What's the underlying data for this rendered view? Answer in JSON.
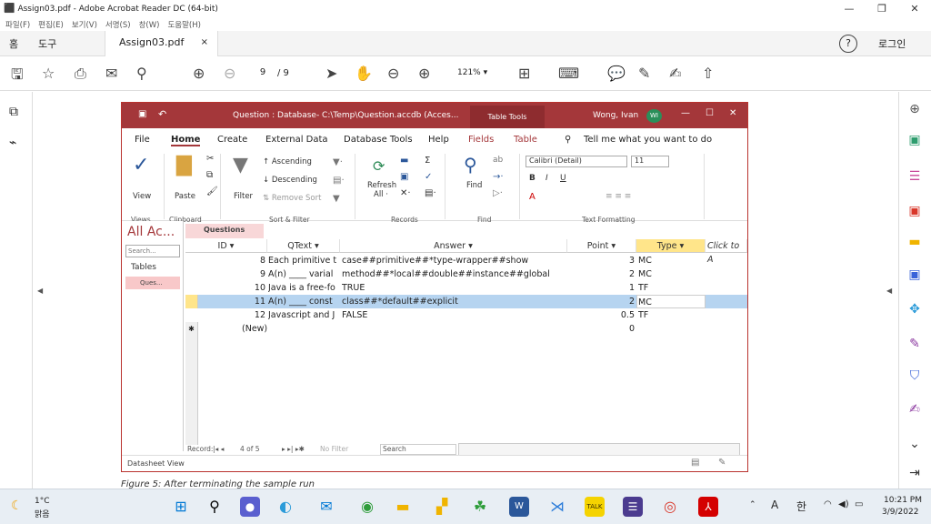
{
  "window": {
    "title": "Assign03.pdf - Adobe Acrobat Reader DC (64-bit)",
    "minimize": "—",
    "restore": "❐",
    "close": "✕"
  },
  "menu": [
    "파일(F)",
    "편집(E)",
    "보기(V)",
    "서명(S)",
    "창(W)",
    "도움말(H)"
  ],
  "tabs": {
    "home": "홈",
    "tools": "도구",
    "doc": "Assign03.pdf",
    "doc_close": "×",
    "help": "?",
    "login": "로그인"
  },
  "toolbar": {
    "page": "9",
    "page_total": "/ 9",
    "zoom": "121%"
  },
  "access": {
    "title": "Question : Database- C:\\Temp\\Question.accdb (Acces...",
    "table_tools": "Table Tools",
    "user": "Wong, Ivan",
    "user_initials": "WI",
    "ribbon_tabs": [
      "File",
      "Home",
      "Create",
      "External Data",
      "Database Tools",
      "Help",
      "Fields",
      "Table"
    ],
    "tell_me": "Tell me what you want to do",
    "ribbon": {
      "view": "View",
      "paste": "Paste",
      "filter": "Filter",
      "ascending": "Ascending",
      "descending": "Descending",
      "remove_sort": "Remove Sort",
      "refresh": "Refresh",
      "all": "All ·",
      "find": "Find",
      "font": "Calibri (Detail)",
      "font_size": "11",
      "groups": [
        "Views",
        "Clipboard",
        "Sort & Filter",
        "Records",
        "Find",
        "Text Formatting"
      ]
    },
    "nav": {
      "title": "All Ac...",
      "search": "Search...",
      "tables": "Tables",
      "item": "Ques..."
    },
    "datasheet": {
      "tab": "Questions",
      "headers": [
        "ID",
        "QText",
        "Answer",
        "Point",
        "Type",
        "Click to A"
      ],
      "rows": [
        {
          "id": "8",
          "qtext": "Each primitive t",
          "answer": "case##primitive##*type-wrapper##show",
          "point": "3",
          "type": "MC"
        },
        {
          "id": "9",
          "qtext": "A(n) ____ varial",
          "answer": "method##*local##double##instance##global",
          "point": "2",
          "type": "MC"
        },
        {
          "id": "10",
          "qtext": "Java is a free-fo",
          "answer": "TRUE",
          "point": "1",
          "type": "TF"
        },
        {
          "id": "11",
          "qtext": "A(n) ____ const",
          "answer": "class##*default##explicit",
          "point": "2",
          "type": "MC"
        },
        {
          "id": "12",
          "qtext": "Javascript and J",
          "answer": "FALSE",
          "point": "0.5",
          "type": "TF"
        }
      ],
      "new_row": "(New)",
      "new_point": "0"
    },
    "record": {
      "label": "Record:",
      "position": "4 of 5",
      "nofilter": "No Filter",
      "search": "Search"
    },
    "status": "Datasheet View"
  },
  "caption": "Figure 5: After terminating the sample run",
  "taskbar": {
    "temp": "1°C",
    "weather": "맑음",
    "lang": "A",
    "ime": "한",
    "time": "10:21 PM",
    "date": "3/9/2022"
  }
}
